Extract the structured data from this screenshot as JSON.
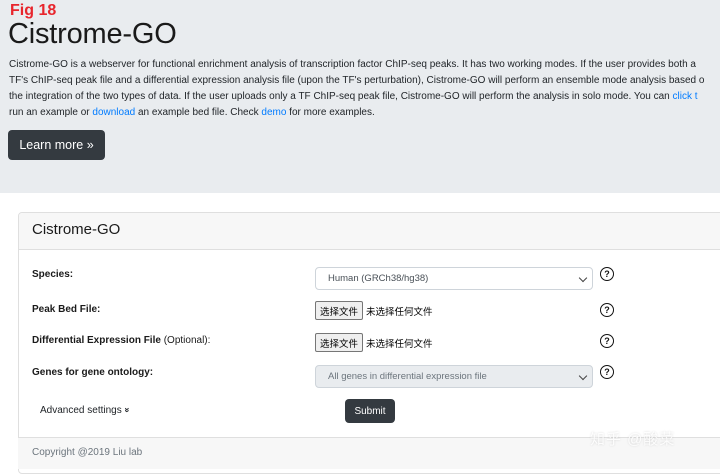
{
  "figure_label": "Fig 18",
  "hero": {
    "title": "Cistrome-GO",
    "line1": "Cistrome-GO is a webserver for functional enrichment analysis of transcription factor ChIP-seq peaks. It has two working modes. If the user provides both a",
    "line2": "TF's ChIP-seq peak file and a differential expression analysis file (upon the TF's perturbation), Cistrome-GO will perform an ensemble mode analysis based o",
    "line3_text": "the integration of the two types of data. If the user uploads only a TF ChIP-seq peak file, Cistrome-GO will perform the analysis in solo mode. You can ",
    "line3_link": "click t",
    "line4_pre": "run an example or ",
    "line4_link1": "download",
    "line4_mid": " an example bed file. Check ",
    "line4_link2": "demo",
    "line4_post": " for more examples.",
    "learn_more": "Learn more »"
  },
  "card": {
    "title": "Cistrome-GO",
    "species_label": "Species:",
    "species_value": "Human (GRCh38/hg38)",
    "peak_label": "Peak Bed File:",
    "diff_label": "Differential Expression File",
    "diff_optional": " (Optional):",
    "genes_label": "Genes for gene ontology:",
    "genes_value": "All genes in differential expression file",
    "choose_file": "选择文件",
    "no_file": "未选择任何文件",
    "help": "?",
    "advanced": "Advanced settings",
    "advanced_icon": "»",
    "submit": "Submit"
  },
  "footer": {
    "text": "Copyright @2019 Liu lab"
  },
  "watermark": "知乎 @酸菜",
  "colors": {
    "accent_link": "#007bff",
    "dark_button": "#343a40",
    "fig_label": "#e8262d"
  }
}
